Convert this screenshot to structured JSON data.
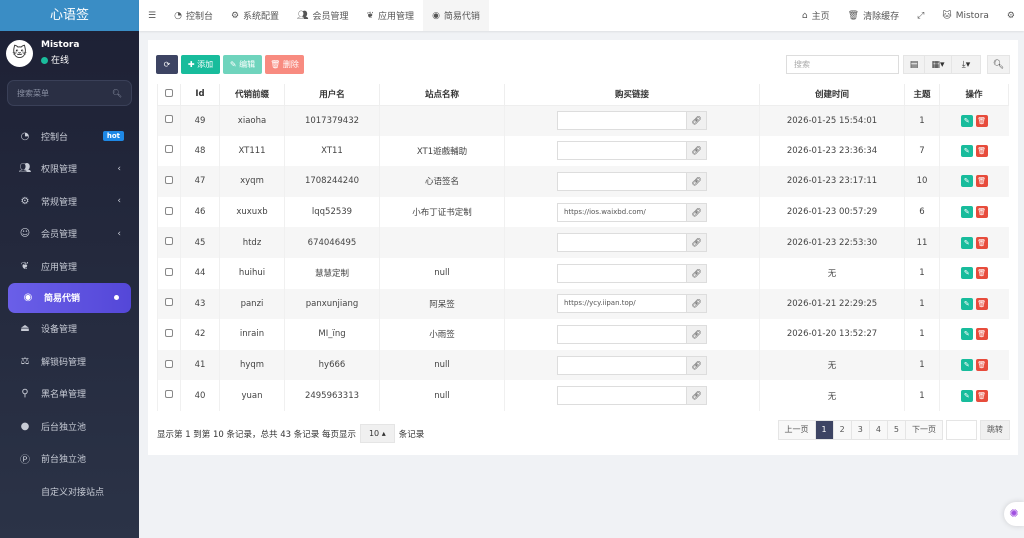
{
  "app": {
    "title": "心语签"
  },
  "user": {
    "name": "Mistora",
    "status": "在线"
  },
  "sidebar": {
    "search_placeholder": "搜索菜单",
    "items": [
      {
        "label": "控制台",
        "icon": "dashboard-icon",
        "badge": "hot"
      },
      {
        "label": "权限管理",
        "icon": "users-icon",
        "arrow": "‹"
      },
      {
        "label": "常规管理",
        "icon": "cogs-icon",
        "arrow": "‹"
      },
      {
        "label": "会员管理",
        "icon": "user-circle-icon",
        "arrow": "‹"
      },
      {
        "label": "应用管理",
        "icon": "leaf-icon"
      },
      {
        "label": "简易代销",
        "icon": "eye-icon",
        "active": true
      },
      {
        "label": "设备管理",
        "icon": "eject-icon"
      },
      {
        "label": "解锁码管理",
        "icon": "balance-scale-icon"
      },
      {
        "label": "黑名单管理",
        "icon": "bicycle-icon"
      },
      {
        "label": "后台独立池",
        "icon": "apple-icon"
      },
      {
        "label": "前台独立池",
        "icon": "parking-icon"
      },
      {
        "label": "自定义对接站点",
        "icon": "code-icon"
      }
    ]
  },
  "header": {
    "tabs": [
      "控制台",
      "系统配置",
      "会员管理",
      "应用管理",
      "简易代销"
    ],
    "home": "主页",
    "clear_cache": "清除缓存",
    "user": "Mistora"
  },
  "toolbar": {
    "add": "添加",
    "edit": "编辑",
    "delete": "删除",
    "search_placeholder": "搜索"
  },
  "table": {
    "columns": [
      "Id",
      "代销前缀",
      "用户名",
      "站点名称",
      "购买链接",
      "创建时间",
      "主题",
      "操作"
    ],
    "rows": [
      {
        "id": "49",
        "prefix": "xiaoha",
        "user": "1017379432",
        "site": "",
        "link": "",
        "time": "2026-01-25 15:54:01",
        "theme": "1"
      },
      {
        "id": "48",
        "prefix": "XT111",
        "user": "XT11",
        "site": "XT1遊戲輔助",
        "link": "",
        "time": "2026-01-23 23:36:34",
        "theme": "7"
      },
      {
        "id": "47",
        "prefix": "xyqm",
        "user": "1708244240",
        "site": "心语签名",
        "link": "",
        "time": "2026-01-23 23:17:11",
        "theme": "10"
      },
      {
        "id": "46",
        "prefix": "xuxuxb",
        "user": "lqq52539",
        "site": "小布丁证书定制",
        "link": "https://ios.waixbd.com/",
        "time": "2026-01-23 00:57:29",
        "theme": "6"
      },
      {
        "id": "45",
        "prefix": "htdz",
        "user": "674046495",
        "site": "",
        "link": "",
        "time": "2026-01-23 22:53:30",
        "theme": "11"
      },
      {
        "id": "44",
        "prefix": "huihui",
        "user": "慧慧定制",
        "site": "null",
        "link": "",
        "time": "无",
        "theme": "1"
      },
      {
        "id": "43",
        "prefix": "panzi",
        "user": "panxunjiang",
        "site": "阿呆签",
        "link": "https://ycy.iipan.top/",
        "time": "2026-01-21 22:29:25",
        "theme": "1"
      },
      {
        "id": "42",
        "prefix": "inrain",
        "user": "MI_ïng",
        "site": "小雨签",
        "link": "",
        "time": "2026-01-20 13:52:27",
        "theme": "1"
      },
      {
        "id": "41",
        "prefix": "hyqm",
        "user": "hy666",
        "site": "null",
        "link": "",
        "time": "无",
        "theme": "1"
      },
      {
        "id": "40",
        "prefix": "yuan",
        "user": "2495963313",
        "site": "null",
        "link": "",
        "time": "无",
        "theme": "1"
      }
    ]
  },
  "footer": {
    "summary": "显示第 1 到第 10 条记录，总共 43 条记录 每页显示",
    "page_size": "10",
    "suffix": "条记录"
  },
  "pagination": {
    "prev": "上一页",
    "pages": [
      "1",
      "2",
      "3",
      "4",
      "5"
    ],
    "current": "1",
    "next": "下一页",
    "jump": "跳转"
  },
  "colors": {
    "primary": "#3d4463",
    "add": "#18bc9c",
    "edit": "#6fd4bd",
    "delete": "#f88b80",
    "active": "#5f54e0"
  }
}
